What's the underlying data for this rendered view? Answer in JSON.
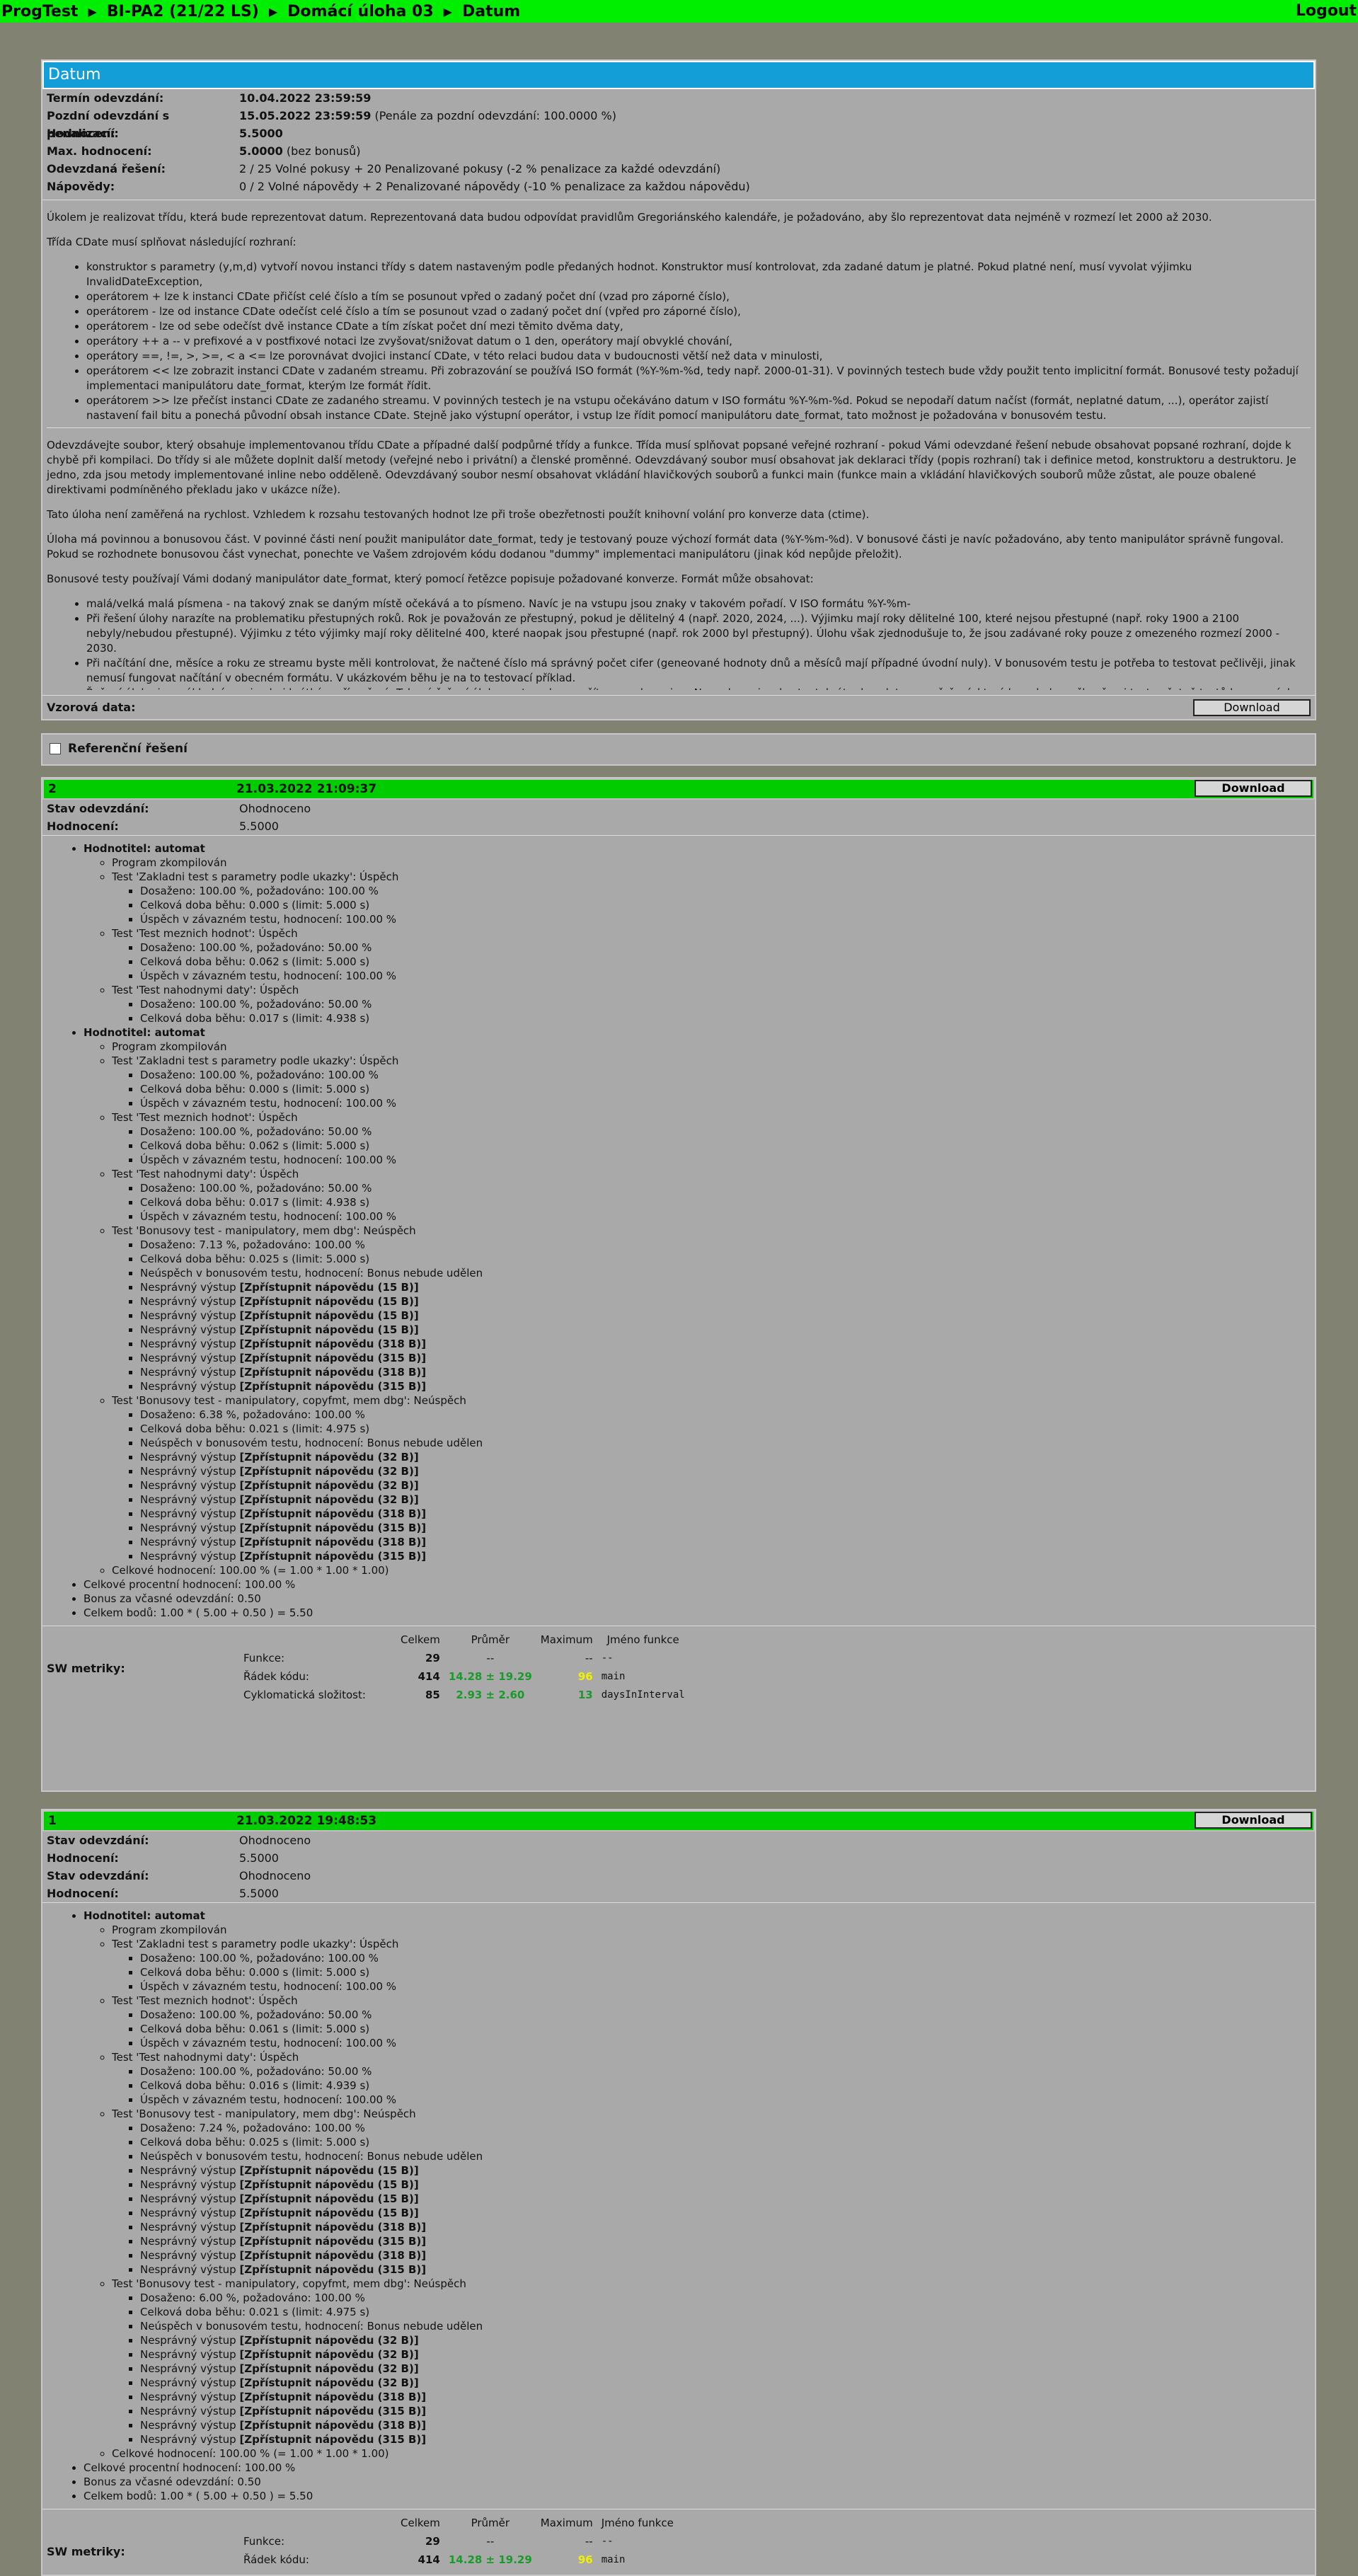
{
  "topbar": {
    "app": "ProgTest",
    "course": "BI-PA2 (21/22 LS)",
    "task": "Domácí úloha 03",
    "page": "Datum",
    "logout": "Logout"
  },
  "task": {
    "title": "Datum",
    "info": [
      {
        "k": "Termín odevzdání:",
        "v": "10.04.2022 23:59:59",
        "note": ""
      },
      {
        "k": "Pozdní odevzdání s penalizací:",
        "v": "15.05.2022 23:59:59",
        "note": "(Penále za pozdní odevzdání: 100.0000 %)"
      },
      {
        "k": "Hodnocení:",
        "v": "5.5000",
        "note": ""
      },
      {
        "k": "Max. hodnocení:",
        "v": "5.0000",
        "note": "(bez bonusů)"
      },
      {
        "k": "Odevzdaná řešení:",
        "v": "",
        "note": "2 / 25 Volné pokusy + 20 Penalizované pokusy (-2 % penalizace za každé odevzdání)"
      },
      {
        "k": "Nápovědy:",
        "v": "",
        "note": "0 / 2 Volné nápovědy + 2 Penalizované nápovědy (-10 % penalizace za každou nápovědu)"
      }
    ],
    "p1": "Úkolem je realizovat třídu, která bude reprezentovat datum. Reprezentovaná data budou odpovídat pravidlům Gregoriánského kalendáře, je požadováno, aby šlo reprezentovat data nejméně v rozmezí let 2000 až 2030.",
    "p2": "Třída CDate musí splňovat následující rozhraní:",
    "bullets": [
      "konstruktor s parametry (y,m,d) vytvoří novou instanci třídy s datem nastaveným podle předaných hodnot. Konstruktor musí kontrolovat, zda zadané datum je platné. Pokud platné není, musí vyvolat výjimku InvalidDateException,",
      "operátorem + lze k instanci CDate přičíst celé číslo a tím se posunout vpřed o zadaný počet dní (vzad pro záporné číslo),",
      "operátorem - lze od instance CDate odečíst celé číslo a tím se posunout vzad o zadaný počet dní (vpřed pro záporné číslo),",
      "operátorem - lze od sebe odečíst dvě instance CDate a tím získat počet dní mezi těmito dvěma daty,",
      "operátory ++ a -- v prefixové a v postfixové notaci lze zvyšovat/snižovat datum o 1 den, operátory mají obvyklé chování,",
      "operátory ==, !=, >, >=, < a <= lze porovnávat dvojici instancí CDate, v této relaci budou data v budoucnosti větší než data v minulosti,",
      "operátorem << lze zobrazit instanci CDate v zadaném streamu. Při zobrazování se používá ISO formát (%Y-%m-%d, tedy např. 2000-01-31). V povinných testech bude vždy použit tento implicitní formát. Bonusové testy požadují implementaci manipulátoru date_format, kterým lze formát řídit.",
      "operátorem >> lze přečíst instanci CDate ze zadaného streamu. V povinných testech je na vstupu očekáváno datum v ISO formátu %Y-%m-%d. Pokud se nepodaří datum načíst (formát, neplatné datum, ...), operátor zajistí nastavení fail bitu a ponechá původní obsah instance CDate. Stejně jako výstupní operátor, i vstup lze řídit pomocí manipulátoru date_format, tato možnost je požadována v bonusovém testu."
    ],
    "p3": "Odevzdávejte soubor, který obsahuje implementovanou třídu CDate a případné další podpůrné třídy a funkce. Třída musí splňovat popsané veřejné rozhraní - pokud Vámi odevzdané řešení nebude obsahovat popsané rozhraní, dojde k chybě při kompilaci. Do třídy si ale můžete doplnit další metody (veřejné nebo i privátní) a členské proměnné. Odevzdávaný soubor musí obsahovat jak deklaraci třídy (popis rozhraní) tak i definice metod, konstruktoru a destruktoru. Je jedno, zda jsou metody implementované inline nebo odděleně. Odevzdávaný soubor nesmí obsahovat vkládání hlavičkových souborů a funkci main (funkce main a vkládání hlavičkových souborů může zůstat, ale pouze obalené direktivami podmíněného překladu jako v ukázce níže).",
    "p4": "Tato úloha není zaměřená na rychlost. Vzhledem k rozsahu testovaných hodnot lze při troše obezřetnosti použít knihovní volání pro konverze data (ctime).",
    "p5": "Úloha má povinnou a bonusovou část. V povinné části není použit manipulátor date_format, tedy je testovaný pouze výchozí formát data (%Y-%m-%d). V bonusové části je navíc požadováno, aby tento manipulátor správně fungoval. Pokud se rozhodnete bonusovou část vynechat, ponechte ve Vašem zdrojovém kódu dodanou \"dummy\" implementaci manipulátoru (jinak kód nepůjde přeložit).",
    "p6": "Bonusové testy používají Vámi dodaný manipulátor date_format, který pomocí řetězce popisuje požadované konverze. Formát může obsahovat:",
    "bullets2": [
      "malá/velká malá písmena - na takový znak se daným místě očekává a to písmeno. Navíc je na vstupu jsou znaky v takovém pořadí. V ISO formátu %Y-%m-",
      "Při řešení úlohy narazíte na problematiku přestupných roků. Rok je považován ze přestupný, pokud je dělitelný 4 (např. 2020, 2024, ...). Výjimku mají roky dělitelné 100, které nejsou přestupné (např. roky 1900 a 2100 nebyly/nebudou přestupné). Výjimku z této výjimky mají roky dělitelné 400, které naopak jsou přestupné (např. rok 2000 byl přestupný). Úlohu však zjednodušuje to, že jsou zadávané roky pouze z omezeného rozmezí 2000 - 2030.",
      "Při načítání dne, měsíce a roku ze streamu byste měli kontrolovat, že načtené číslo má správný počet cifer (geneované hodnoty dnů a měsíců mají případné úvodní nuly). V bonusovém testu je potřeba to testovat pečlivěji, jinak nemusí fungovat načítání v obecném formátu. V ukázkovém běhu je na to testovací příklad.",
      "Řešení úlohy je v základní verzi velmi krátké a přímočaré. Takové řešení úlohy proto nelze použít pro code review. Na code review lze tentokrát odevzdat pouze řešení, které bez chyb prošlo všemi testy včetně testů bonusových."
    ],
    "sample_label": "Vzorová data:",
    "download": "Download"
  },
  "reference": {
    "label": "Referenční řešení"
  },
  "submissions": [
    {
      "num": "2",
      "date": "21.03.2022 21:09:37",
      "download": "Download",
      "rows": [
        {
          "k": "Stav odevzdání:",
          "v": "Ohodnoceno"
        },
        {
          "k": "Hodnocení:",
          "v": "5.5000"
        }
      ],
      "metrics": {
        "label": "SW metriky:",
        "headers": [
          "Celkem",
          "Průměr",
          "Maximum",
          "Jméno funkce"
        ],
        "rows": [
          {
            "name": "Funkce:",
            "total": "29",
            "avg": "--",
            "max": "--",
            "fn": "--"
          },
          {
            "name": "Řádek kódu:",
            "total": "414",
            "avg": "14.28 ± 19.29",
            "max": "96",
            "fn": "main"
          },
          {
            "name": "Cyklomatická složitost:",
            "total": "85",
            "avg": "2.93 ± 2.60",
            "max": "13",
            "fn": "daysInInterval"
          }
        ]
      }
    },
    {
      "num": "1",
      "date": "21.03.2022 19:48:53",
      "download": "Download",
      "rows": [
        {
          "k": "Stav odevzdání:",
          "v": "Ohodnoceno"
        },
        {
          "k": "Hodnocení:",
          "v": "5.5000"
        },
        {
          "k": "Stav odevzdání:",
          "v": "Ohodnoceno"
        },
        {
          "k": "Hodnocení:",
          "v": "5.5000"
        }
      ],
      "metrics": {
        "label": "SW metriky:",
        "headers": [
          "Celkem",
          "Průměr",
          "Maximum",
          "Jméno funkce"
        ],
        "rows": [
          {
            "name": "Funkce:",
            "total": "29",
            "avg": "--",
            "max": "--",
            "fn": "--"
          },
          {
            "name": "Řádek kódu:",
            "total": "414",
            "avg": "14.28 ± 19.29",
            "max": "96",
            "fn": "main"
          }
        ]
      }
    }
  ],
  "tree": {
    "evaluator": "Hodnotitel: automat",
    "compiled": "Program zkompilován",
    "t1": "Test 'Zakladni test s parametry podle ukazky': Úspěch",
    "t2": "Test 'Test meznich hodnot': Úspěch",
    "t3": "Test 'Test nahodnymi daty': Úspěch",
    "t4": "Test 'Bonusovy test - manipulatory, mem dbg': Neúspěch",
    "t5": "Test 'Bonusovy test - manipulatory, copyfmt, mem dbg': Neúspěch",
    "a100": "Dosaženo: 100.00 %, požadováno: 100.00 %",
    "a50": "Dosaženo: 100.00 %, požadováno: 50.00 %",
    "a713": "Dosaženo: 7.13 %, požadováno: 100.00 %",
    "a724": "Dosaženo: 7.24 %, požadováno: 100.00 %",
    "a638": "Dosaženo: 6.38 %, požadováno: 100.00 %",
    "a600": "Dosaženo: 6.00 %, požadováno: 100.00 %",
    "d000": "Celková doba běhu: 0.000 s (limit: 5.000 s)",
    "d062": "Celková doba běhu: 0.062 s (limit: 5.000 s)",
    "d061": "Celková doba běhu: 0.061 s (limit: 5.000 s)",
    "d017": "Celková doba běhu: 0.017 s (limit: 4.938 s)",
    "d016": "Celková doba běhu: 0.016 s (limit: 4.939 s)",
    "d025": "Celková doba běhu: 0.025 s (limit: 5.000 s)",
    "d021": "Celková doba běhu: 0.021 s (limit: 4.975 s)",
    "ok": "Úspěch v závazném testu, hodnocení: 100.00 %",
    "bonusfail": "Neúspěch v bonusovém testu, hodnocení: Bonus nebude udělen",
    "wrong": "Nesprávný výstup",
    "h15": "[Zpřístupnit nápovědu (15 B)]",
    "h318": "[Zpřístupnit nápovědu (318 B)]",
    "h315": "[Zpřístupnit nápovědu (315 B)]",
    "h32": "[Zpřístupnit nápovědu (32 B)]",
    "overall": "Celkové hodnocení: 100.00 % (= 1.00 * 1.00 * 1.00)",
    "pct": "Celkové procentní hodnocení: 100.00 %",
    "bonus": "Bonus za včasné odevzdání: 0.50",
    "points": "Celkem bodů: 1.00 * ( 5.00 + 0.50 ) = 5.50"
  }
}
